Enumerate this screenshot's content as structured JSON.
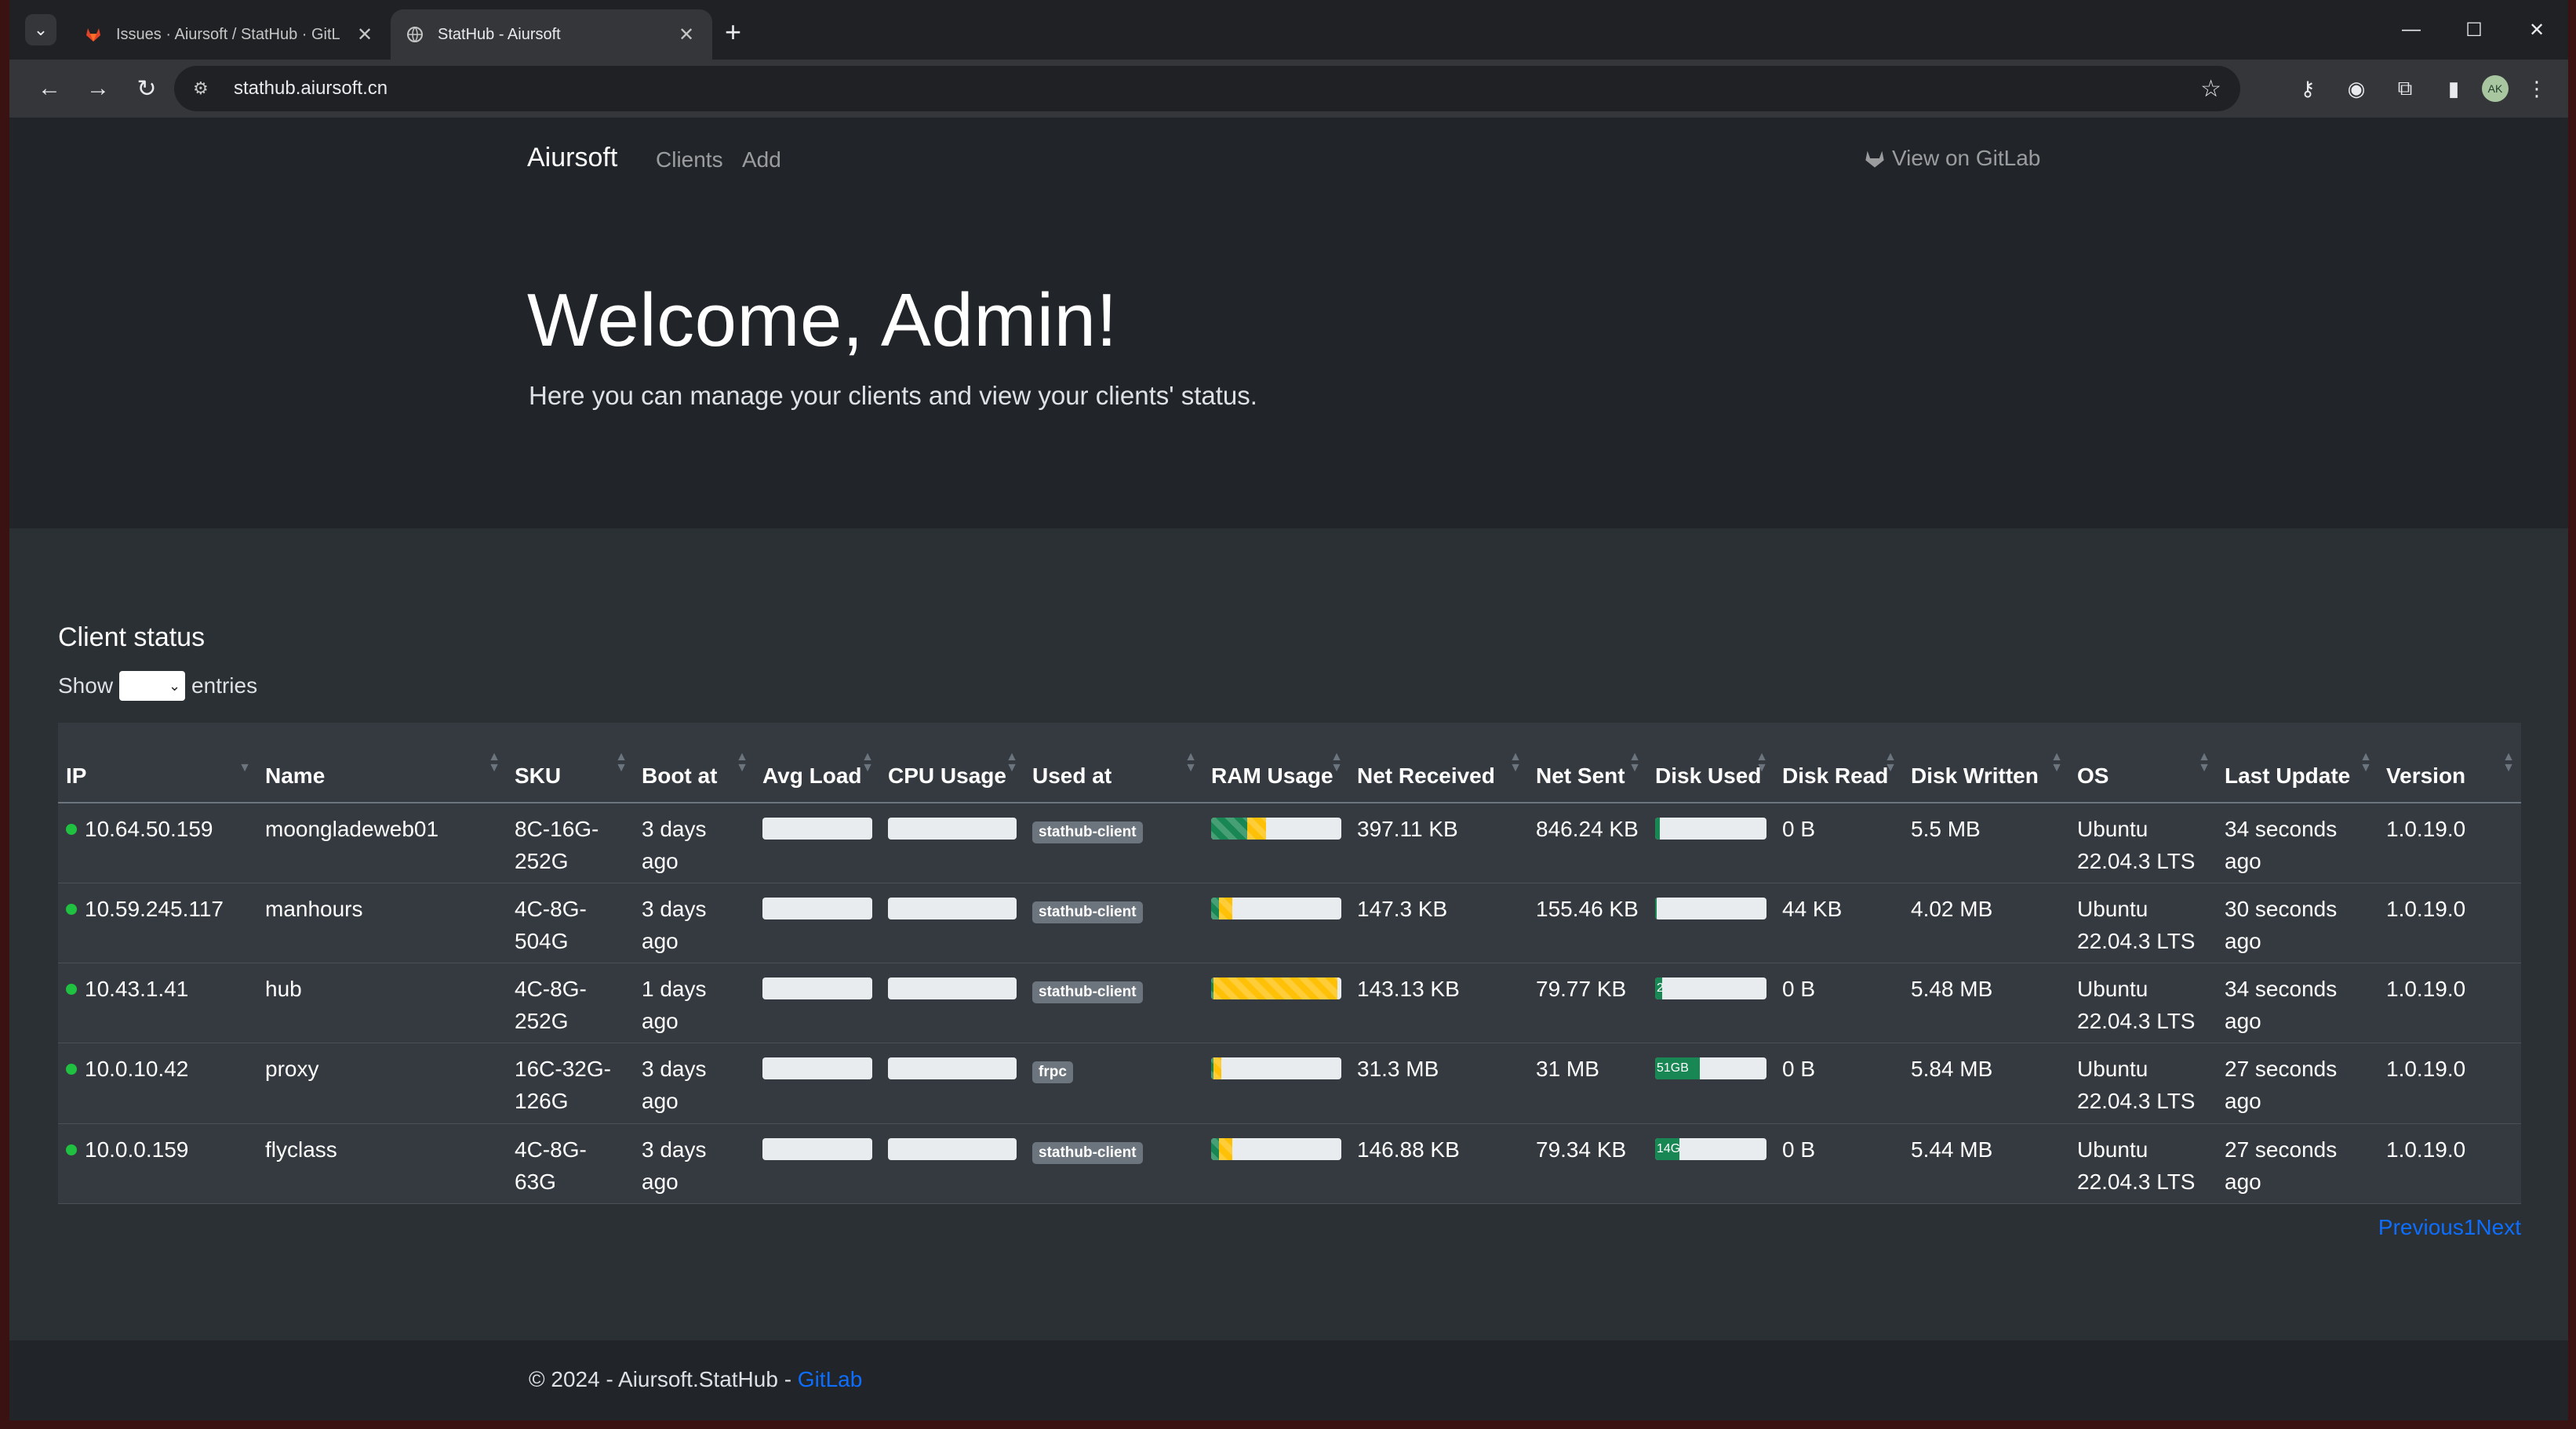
{
  "browser": {
    "tabs": [
      {
        "title": "Issues · Aiursoft / StatHub · GitL",
        "active": false
      },
      {
        "title": "StatHub - Aiursoft",
        "active": true
      }
    ],
    "url": "stathub.aiursoft.cn"
  },
  "navbar": {
    "brand": "Aiursoft",
    "links": [
      "Clients",
      "Add"
    ],
    "gitlab": "View on GitLab"
  },
  "hero": {
    "title": "Welcome, Admin!",
    "subtitle": "Here you can manage your clients and view your clients' status."
  },
  "status": {
    "title": "Client status",
    "show": "Show",
    "entries": "entries",
    "columns": [
      "IP",
      "Name",
      "SKU",
      "Boot at",
      "Avg Load",
      "CPU Usage",
      "Used at",
      "RAM Usage",
      "Net Received",
      "Net Sent",
      "Disk Used",
      "Disk Read",
      "Disk Written",
      "OS",
      "Last Update",
      "Version"
    ],
    "rows": [
      {
        "ip": "10.64.50.159",
        "name": "moongladeweb01",
        "sku": "8C-16G-252G",
        "boot": "3 days ago",
        "load": 0,
        "cpu": 0,
        "used_at": "stathub-client",
        "ram_green": 0.28,
        "ram_yellow": 0.14,
        "net_rx": "397.11 KB",
        "net_tx": "846.24 KB",
        "disk_pct": 0.04,
        "disk_label": "",
        "disk_read": "0 B",
        "disk_written": "5.5 MB",
        "os": "Ubuntu 22.04.3 LTS",
        "updated": "34 seconds ago",
        "version": "1.0.19.0"
      },
      {
        "ip": "10.59.245.117",
        "name": "manhours",
        "sku": "4C-8G-504G",
        "boot": "3 days ago",
        "load": 0,
        "cpu": 0,
        "used_at": "stathub-client",
        "ram_green": 0.06,
        "ram_yellow": 0.1,
        "net_rx": "147.3 KB",
        "net_tx": "155.46 KB",
        "disk_pct": 0.01,
        "disk_label": "",
        "disk_read": "44 KB",
        "disk_written": "4.02 MB",
        "os": "Ubuntu 22.04.3 LTS",
        "updated": "30 seconds ago",
        "version": "1.0.19.0"
      },
      {
        "ip": "10.43.1.41",
        "name": "hub",
        "sku": "4C-8G-252G",
        "boot": "1 days ago",
        "load": 0,
        "cpu": 0,
        "used_at": "stathub-client",
        "ram_green": 0.02,
        "ram_yellow": 0.95,
        "net_rx": "143.13 KB",
        "net_tx": "79.77 KB",
        "disk_pct": 0.06,
        "disk_label": "2",
        "disk_read": "0 B",
        "disk_written": "5.48 MB",
        "os": "Ubuntu 22.04.3 LTS",
        "updated": "34 seconds ago",
        "version": "1.0.19.0"
      },
      {
        "ip": "10.0.10.42",
        "name": "proxy",
        "sku": "16C-32G-126G",
        "boot": "3 days ago",
        "load": 0,
        "cpu": 0,
        "used_at": "frpc",
        "ram_green": 0.02,
        "ram_yellow": 0.06,
        "net_rx": "31.3 MB",
        "net_tx": "31 MB",
        "disk_pct": 0.4,
        "disk_label": "51GB",
        "disk_read": "0 B",
        "disk_written": "5.84 MB",
        "os": "Ubuntu 22.04.3 LTS",
        "updated": "27 seconds ago",
        "version": "1.0.19.0"
      },
      {
        "ip": "10.0.0.159",
        "name": "flyclass",
        "sku": "4C-8G-63G",
        "boot": "3 days ago",
        "load": 0,
        "cpu": 0,
        "used_at": "stathub-client",
        "ram_green": 0.06,
        "ram_yellow": 0.1,
        "net_rx": "146.88 KB",
        "net_tx": "79.34 KB",
        "disk_pct": 0.22,
        "disk_label": "14G",
        "disk_read": "0 B",
        "disk_written": "5.44 MB",
        "os": "Ubuntu 22.04.3 LTS",
        "updated": "27 seconds ago",
        "version": "1.0.19.0"
      }
    ],
    "pager": {
      "prev": "Previous",
      "page": "1",
      "next": "Next"
    }
  },
  "footer": {
    "text": "© 2024 - Aiursoft.StatHub - ",
    "link": "GitLab"
  },
  "colors": {
    "accent": "#0d6efd",
    "online": "#20c040",
    "ram_green": "#198754",
    "ram_yellow": "#ffc107"
  }
}
